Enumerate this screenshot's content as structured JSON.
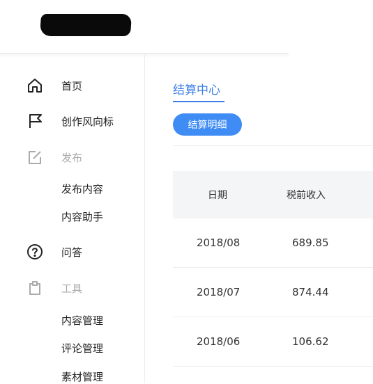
{
  "header": {
    "account_name_redacted": true
  },
  "sidebar": {
    "items": [
      {
        "label": "首页",
        "icon": "home-icon"
      },
      {
        "label": "创作风向标",
        "icon": "flag-icon"
      },
      {
        "label": "发布",
        "icon": "edit-icon",
        "muted": true
      },
      {
        "label": "发布内容"
      },
      {
        "label": "内容助手"
      },
      {
        "label": "问答",
        "icon": "question-icon"
      },
      {
        "label": "工具",
        "icon": "clipboard-icon",
        "muted": true
      },
      {
        "label": "内容管理"
      },
      {
        "label": "评论管理"
      },
      {
        "label": "素材管理"
      }
    ]
  },
  "main": {
    "tab_title": "结算中心",
    "pill_label": "结算明细",
    "table": {
      "headers": [
        "日期",
        "税前收入"
      ],
      "rows": [
        {
          "date": "2018/08",
          "income": "689.85"
        },
        {
          "date": "2018/07",
          "income": "874.44"
        },
        {
          "date": "2018/06",
          "income": "106.62"
        }
      ]
    }
  },
  "colors": {
    "accent": "#3d7ee6",
    "pill": "#3f8cf5",
    "muted": "#aaaaaa"
  }
}
